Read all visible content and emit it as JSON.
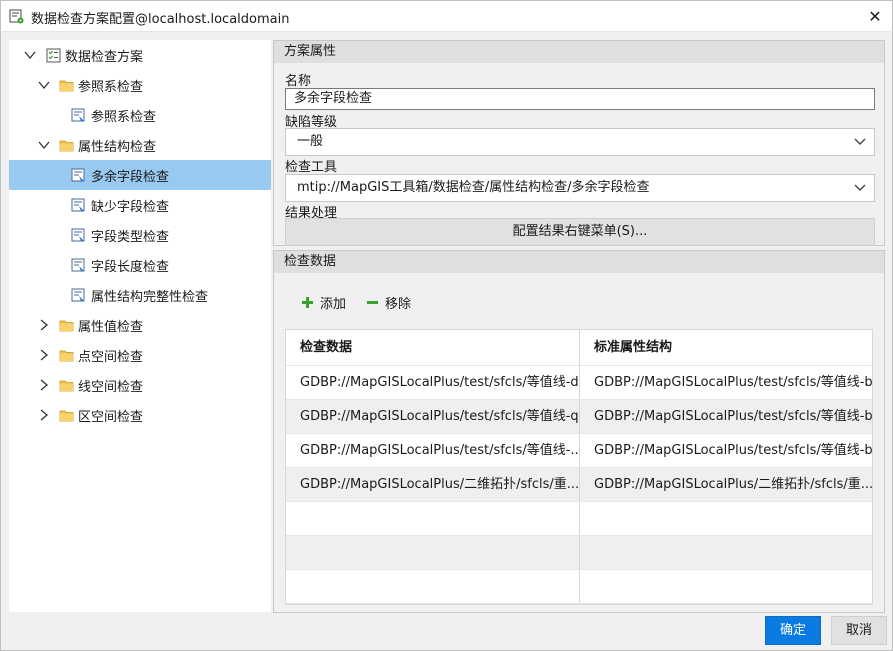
{
  "window": {
    "title": "数据检查方案配置@localhost.localdomain"
  },
  "tree": {
    "nodes": [
      {
        "label": "数据检查方案",
        "level": 0,
        "expanded": true,
        "icon": "checklist-icon"
      },
      {
        "label": "参照系检查",
        "level": 1,
        "expanded": true,
        "icon": "folder-icon"
      },
      {
        "label": "参照系检查",
        "level": 2,
        "icon": "check-rule-icon"
      },
      {
        "label": "属性结构检查",
        "level": 1,
        "expanded": true,
        "icon": "folder-icon"
      },
      {
        "label": "多余字段检查",
        "level": 2,
        "icon": "check-rule-icon",
        "selected": true
      },
      {
        "label": "缺少字段检查",
        "level": 2,
        "icon": "check-rule-icon"
      },
      {
        "label": "字段类型检查",
        "level": 2,
        "icon": "check-rule-icon"
      },
      {
        "label": "字段长度检查",
        "level": 2,
        "icon": "check-rule-icon"
      },
      {
        "label": "属性结构完整性检查",
        "level": 2,
        "icon": "check-rule-icon"
      },
      {
        "label": "属性值检查",
        "level": 1,
        "expanded": false,
        "icon": "folder-icon"
      },
      {
        "label": "点空间检查",
        "level": 1,
        "expanded": false,
        "icon": "folder-icon"
      },
      {
        "label": "线空间检查",
        "level": 1,
        "expanded": false,
        "icon": "folder-icon"
      },
      {
        "label": "区空间检查",
        "level": 1,
        "expanded": false,
        "icon": "folder-icon"
      }
    ]
  },
  "scheme": {
    "header": "方案属性",
    "name_label": "名称",
    "name_value": "多余字段检查",
    "severity_label": "缺陷等级",
    "severity_value": "一般",
    "tool_label": "检查工具",
    "tool_value": "mtip://MapGIS工具箱/数据检查/属性结构检查/多余字段检查",
    "result_label": "结果处理",
    "config_button": "配置结果右键菜单(S)..."
  },
  "checkdata": {
    "header": "检查数据",
    "add_label": "添加",
    "remove_label": "移除",
    "columns": [
      "检查数据",
      "标准属性结构"
    ],
    "rows": [
      [
        "GDBP://MapGISLocalPlus/test/sfcls/等值线-dy",
        "GDBP://MapGISLocalPlus/test/sfcls/等值线-bz"
      ],
      [
        "GDBP://MapGISLocalPlus/test/sfcls/等值线-qs",
        "GDBP://MapGISLocalPlus/test/sfcls/等值线-bz"
      ],
      [
        "GDBP://MapGISLocalPlus/test/sfcls/等值线-...",
        "GDBP://MapGISLocalPlus/test/sfcls/等值线-bz"
      ],
      [
        "GDBP://MapGISLocalPlus/二维拓扑/sfcls/重...",
        "GDBP://MapGISLocalPlus/二维拓扑/sfcls/重..."
      ],
      [
        "",
        ""
      ],
      [
        "",
        ""
      ],
      [
        "",
        ""
      ]
    ]
  },
  "footer": {
    "ok_label": "确定",
    "cancel_label": "取消"
  },
  "colors": {
    "accent": "#0a7be0",
    "selection": "#99c9ef",
    "add_green": "#3aa12f"
  }
}
